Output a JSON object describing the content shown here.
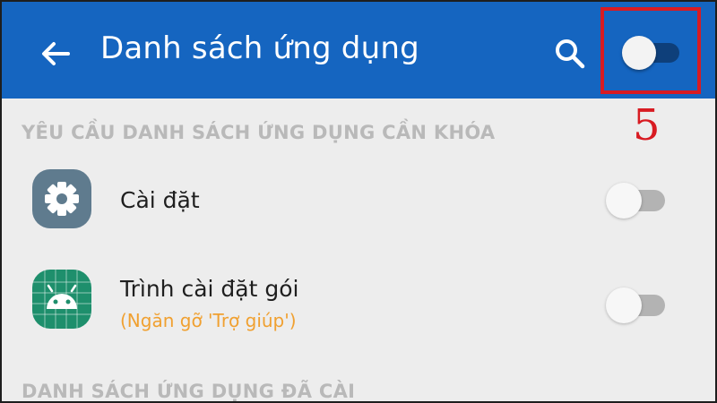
{
  "colors": {
    "appbar": "#1565c0",
    "background": "#ededed",
    "highlight": "#d81b22",
    "section_header": "#b9b9b9",
    "subtitle": "#f0a030"
  },
  "header": {
    "title": "Danh sách ứng dụng",
    "back_icon": "arrow-left-icon",
    "search_icon": "search-icon",
    "toggle_state": "off"
  },
  "annotation": {
    "step_number": "5"
  },
  "sections": [
    {
      "title": "YÊU CẦU DANH SÁCH ỨNG DỤNG CẦN KHÓA",
      "items": [
        {
          "title": "Cài đặt",
          "subtitle": "",
          "icon": "gear-icon",
          "toggle_state": "off"
        },
        {
          "title": "Trình cài đặt gói",
          "subtitle": "(Ngăn gỡ 'Trợ giúp')",
          "icon": "android-icon",
          "toggle_state": "off"
        }
      ]
    },
    {
      "title": "DANH SÁCH ỨNG DỤNG ĐÃ CÀI",
      "items": []
    }
  ]
}
